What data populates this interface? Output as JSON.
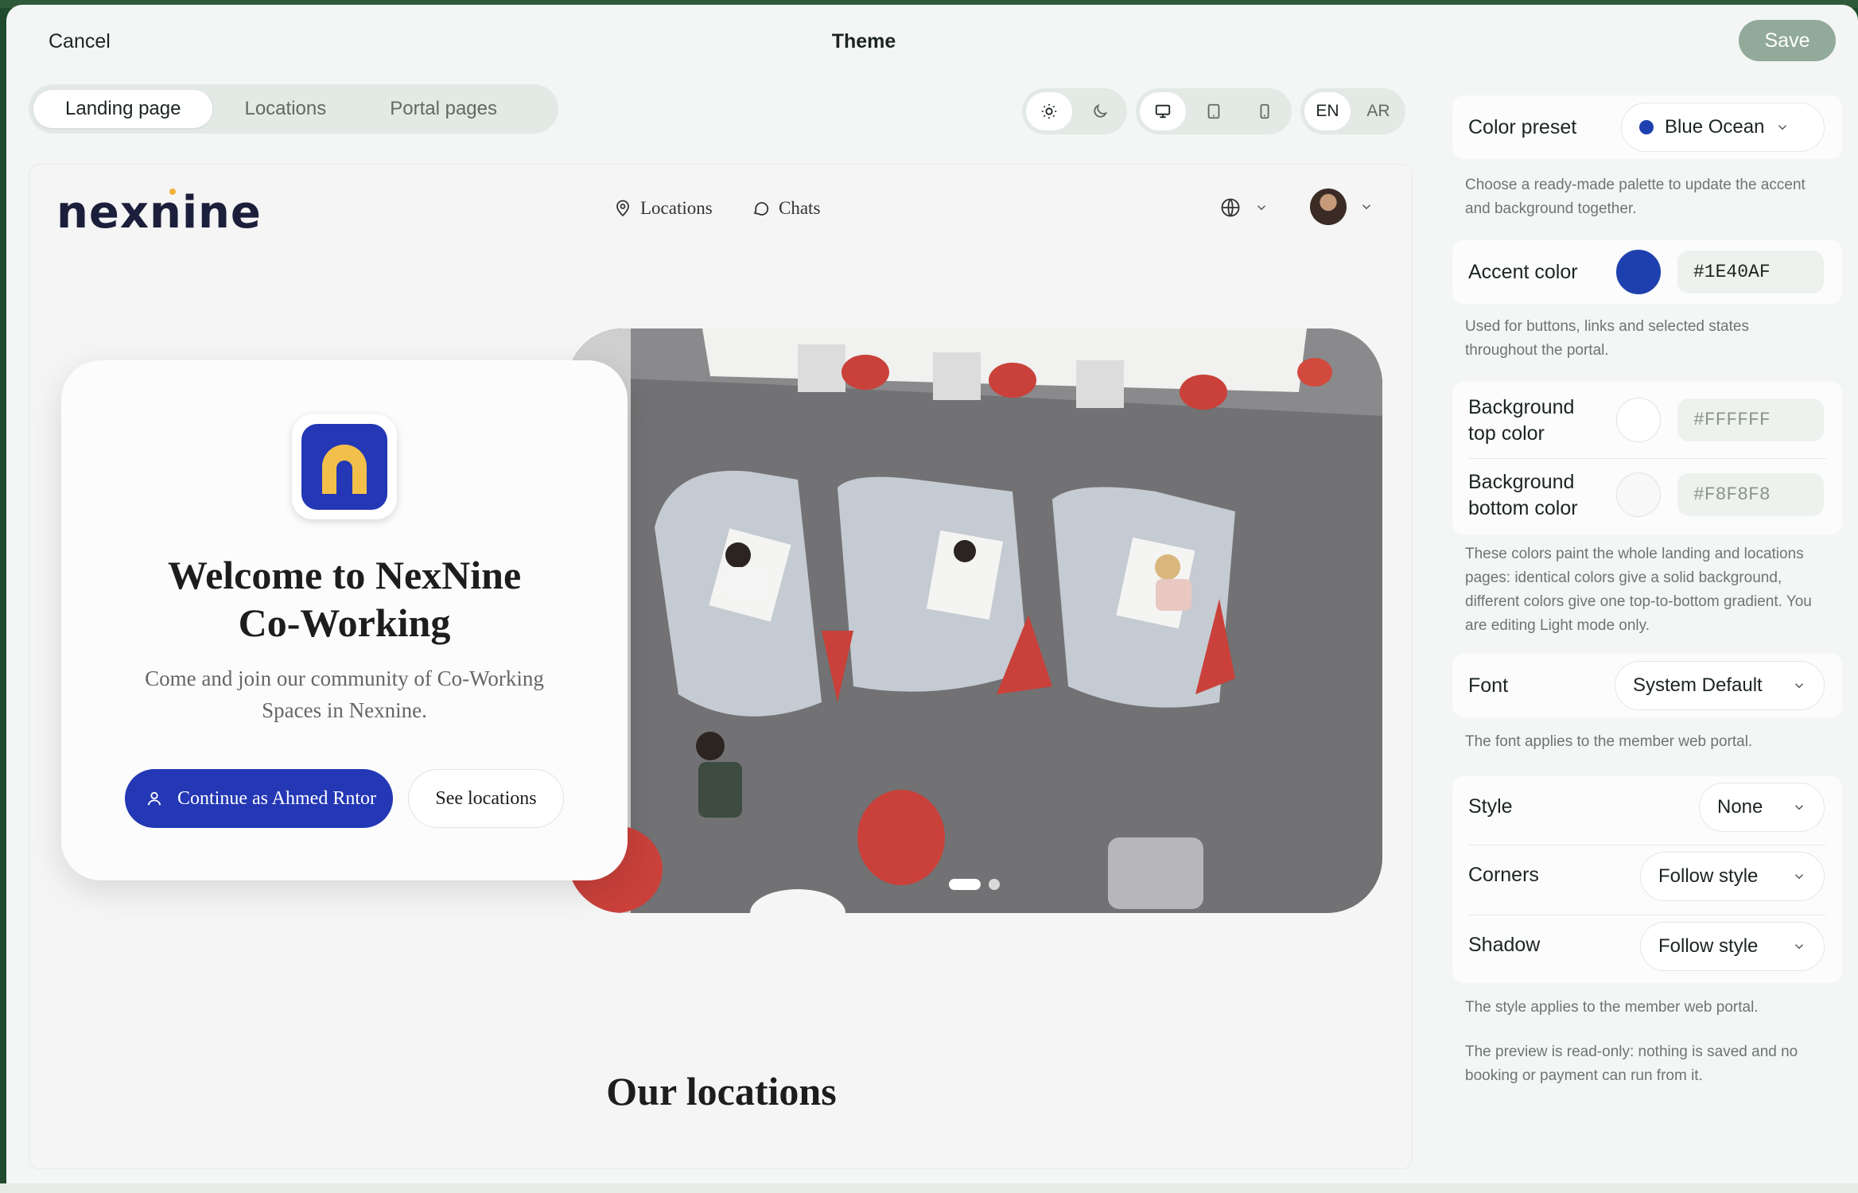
{
  "header": {
    "cancel_label": "Cancel",
    "title": "Theme",
    "save_label": "Save"
  },
  "tabs": [
    {
      "label": "Landing page",
      "active": true
    },
    {
      "label": "Locations",
      "active": false
    },
    {
      "label": "Portal pages",
      "active": false
    }
  ],
  "toggles": {
    "theme": {
      "options": [
        "sun-icon",
        "moon-icon"
      ],
      "selected": "light"
    },
    "device": {
      "options": [
        "desktop-icon",
        "tablet-icon",
        "mobile-icon"
      ],
      "selected": "desktop"
    },
    "language": {
      "options": [
        "EN",
        "AR"
      ],
      "selected": "EN"
    }
  },
  "preview": {
    "brand": "nexnine",
    "nav": {
      "locations": "Locations",
      "chats": "Chats"
    },
    "hero": {
      "title_line1": "Welcome to NexNine",
      "title_line2": "Co-Working",
      "subtitle_line1": "Come and join our community of Co-Working",
      "subtitle_line2": "Spaces in Nexnine.",
      "primary_button": "Continue as Ahmed Rntor",
      "secondary_button": "See locations"
    },
    "carousel": {
      "slides": 2,
      "current": 1
    },
    "section_title": "Our locations"
  },
  "settings": {
    "color_preset": {
      "label": "Color preset",
      "value": "Blue Ocean",
      "swatch": "#1E40AF",
      "note_line1": "Choose a ready-made palette to update the accent",
      "note_line2": "and background together."
    },
    "accent_color": {
      "label": "Accent color",
      "value": "#1E40AF",
      "note_line1": "Used for buttons, links and selected states",
      "note_line2": "throughout the portal."
    },
    "background": {
      "top_label_line1": "Background",
      "top_label_line2": "top color",
      "top_value": "#FFFFFF",
      "bottom_label_line1": "Background",
      "bottom_label_line2": "bottom color",
      "bottom_value": "#F8F8F8",
      "note_line1": "These colors paint the whole landing and locations",
      "note_line2": "pages: identical colors give a solid background,",
      "note_line3": "different colors give one top-to-bottom gradient. You",
      "note_line4": "are editing Light mode only."
    },
    "font": {
      "label": "Font",
      "value": "System Default",
      "note": "The font applies to the member web portal."
    },
    "style": {
      "label": "Style",
      "value": "None",
      "corners_label": "Corners",
      "corners_value": "Follow style",
      "shadow_label": "Shadow",
      "shadow_value": "Follow style",
      "note": "The style applies to the member web portal."
    },
    "readonly_note_line1": "The preview is read-only: nothing is saved and no",
    "readonly_note_line2": "booking or payment can run from it."
  },
  "colors": {
    "accent": "#1E40AF",
    "brand_navy": "#1B1F3B",
    "save_disabled": "#92AA99"
  }
}
